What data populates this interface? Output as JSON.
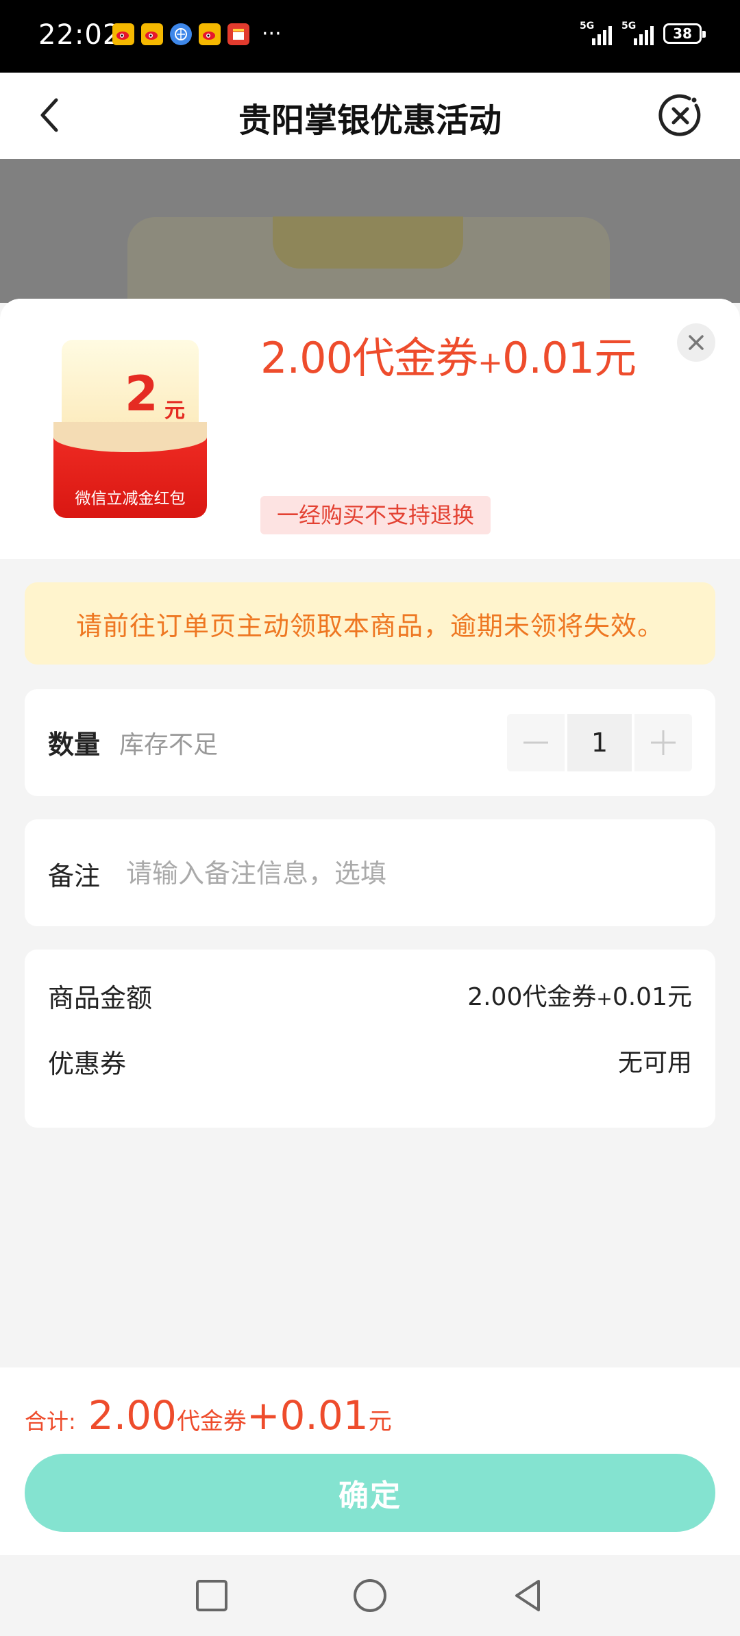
{
  "status_bar": {
    "time": "22:02",
    "notification_icons": [
      "weibo-icon",
      "weibo-icon",
      "browser-icon",
      "weibo-icon",
      "app-icon"
    ],
    "more": "···",
    "network_5g_1": "5G",
    "network_5g_2": "5G",
    "battery": "38"
  },
  "header": {
    "title": "贵阳掌银优惠活动"
  },
  "product": {
    "coupon_amount": "2",
    "coupon_unit": "元",
    "coupon_label": "微信立减金红包",
    "price_main": "2.00代金券",
    "price_plus": "+",
    "price_cash": "0.01元",
    "refund_tag": "一经购买不支持退换"
  },
  "notice": "请前往订单页主动领取本商品，逾期未领将失效。",
  "quantity": {
    "label": "数量",
    "stock_text": "库存不足",
    "value": "1"
  },
  "remark": {
    "label": "备注",
    "placeholder": "请输入备注信息，选填"
  },
  "amounts": {
    "goods_label": "商品金额",
    "goods_value_main": "2.00代金券",
    "goods_value_plus": "+",
    "goods_value_cash": "0.01元",
    "coupon_label": "优惠券",
    "coupon_value": "无可用"
  },
  "footer": {
    "total_label": "合计:",
    "total_num1": "2.00",
    "total_unit1": "代金券",
    "total_num2": "+0.01",
    "total_unit2": "元",
    "confirm": "确定"
  },
  "colors": {
    "accent_red": "#ee4c2c",
    "confirm_green": "#84e3d0",
    "notice_bg": "#fff4cd",
    "notice_text": "#ee7722"
  }
}
